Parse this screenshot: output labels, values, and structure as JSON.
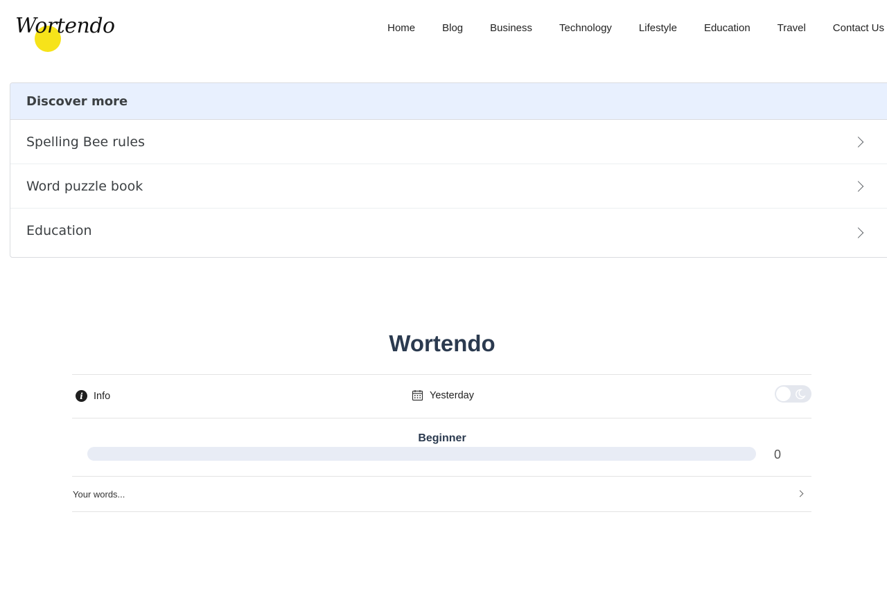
{
  "header": {
    "logo_text": "Wortendo",
    "nav": [
      "Home",
      "Blog",
      "Business",
      "Technology",
      "Lifestyle",
      "Education",
      "Travel",
      "Contact Us"
    ]
  },
  "discover": {
    "title": "Discover more",
    "items": [
      "Spelling Bee rules",
      "Word puzzle book",
      "Education"
    ]
  },
  "game": {
    "title": "Wortendo",
    "info_label": "Info",
    "yesterday_label": "Yesterday",
    "level": "Beginner",
    "score": "0",
    "progress_fraction": 0,
    "words_label": "Your words..."
  },
  "colors": {
    "accent_yellow": "#f6e31a",
    "title_navy": "#2b3a4f",
    "discover_header_bg": "#e8f0fe",
    "progress_track": "#e8ecf5"
  },
  "icons": {
    "info": "info-circle-icon",
    "calendar": "calendar-icon",
    "dark_mode": "moon-icon",
    "chevron": "chevron-right-icon"
  }
}
